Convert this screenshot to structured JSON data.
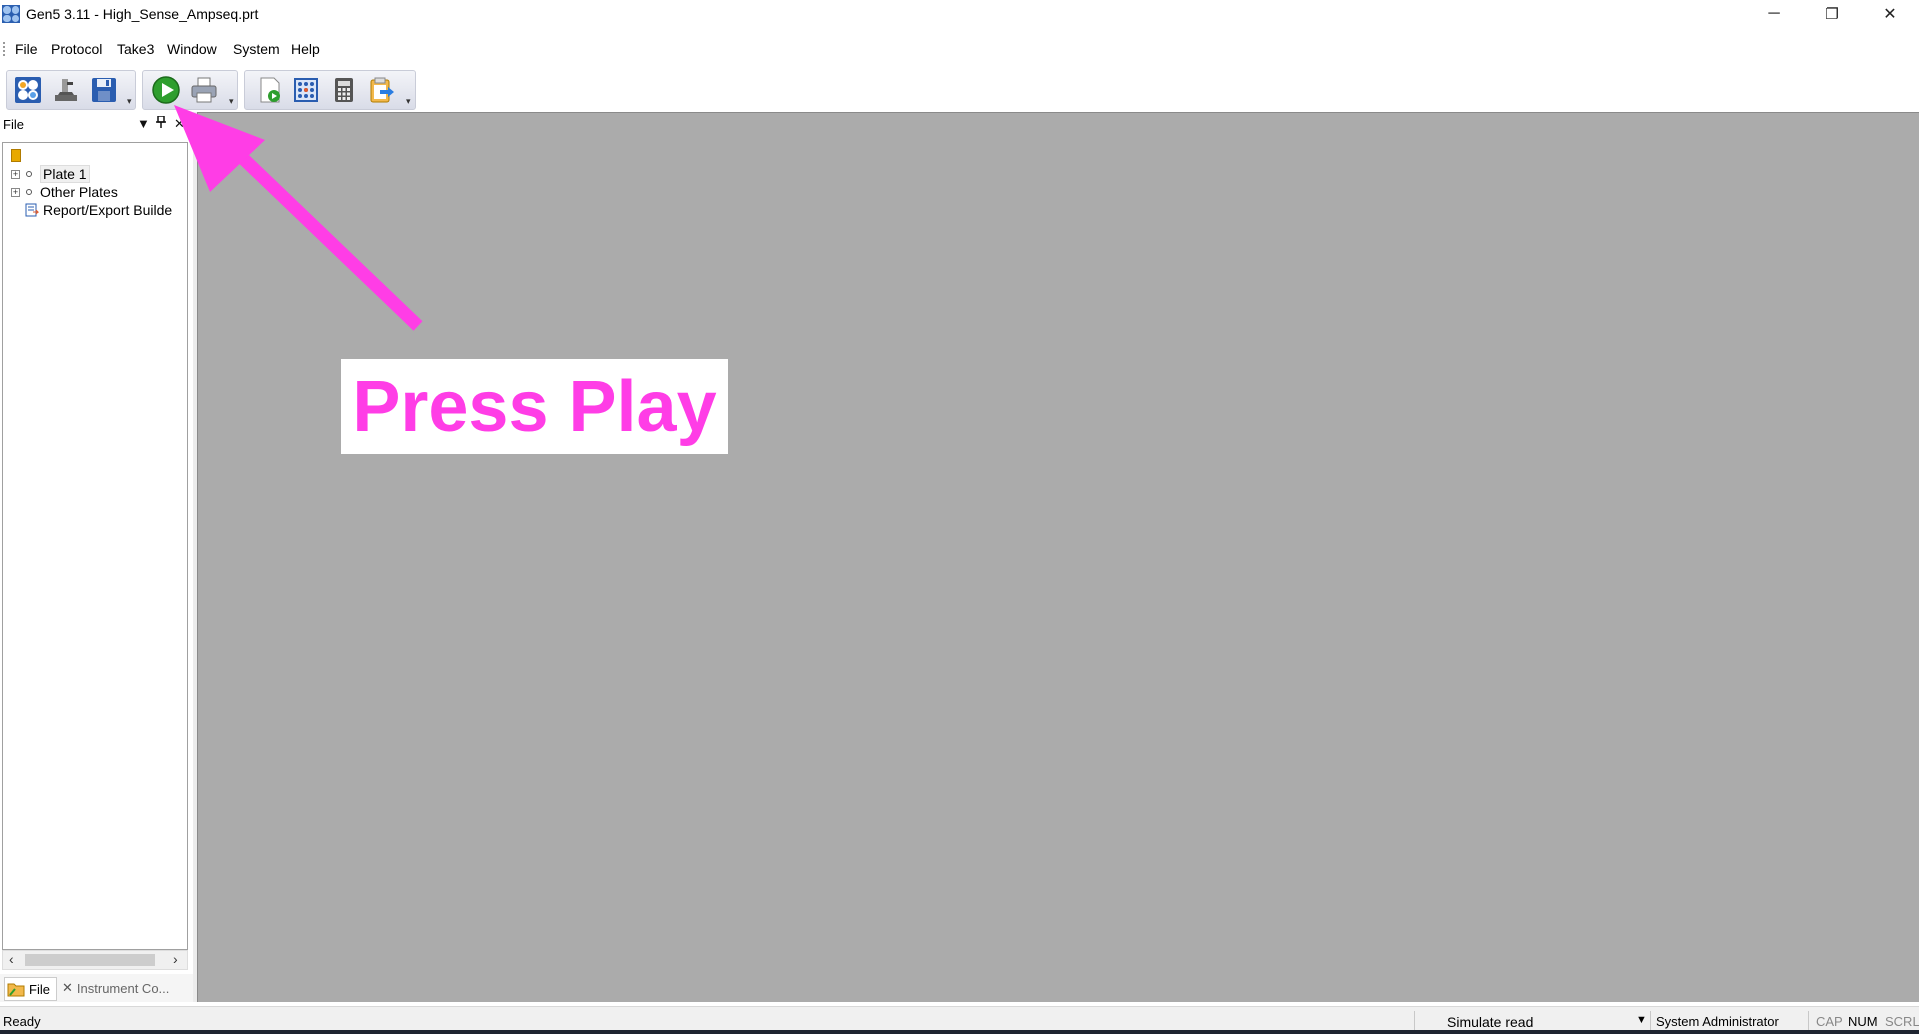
{
  "window": {
    "title": "Gen5 3.11 - High_Sense_Ampseq.prt",
    "controls": {
      "minimize": "─",
      "restore": "❐",
      "close": "✕"
    }
  },
  "menu": {
    "items": [
      {
        "label": "File"
      },
      {
        "label": "Protocol"
      },
      {
        "label": "Take3"
      },
      {
        "label": "Window"
      },
      {
        "label": "System"
      },
      {
        "label": "Help"
      }
    ]
  },
  "toolbar": {
    "buttons": [
      {
        "icon": "plate-layout-icon"
      },
      {
        "icon": "reader-control-icon"
      },
      {
        "icon": "save-icon"
      },
      {
        "icon": "play-read-icon"
      },
      {
        "icon": "print-icon"
      },
      {
        "icon": "new-experiment-icon"
      },
      {
        "icon": "plate-view-icon"
      },
      {
        "icon": "calculator-icon"
      },
      {
        "icon": "export-icon"
      }
    ]
  },
  "file_panel": {
    "title": "File",
    "tree": [
      {
        "label": "Plate 1",
        "expandable": true,
        "selected": true
      },
      {
        "label": "Other Plates",
        "expandable": true
      },
      {
        "label": "Report/Export Builde",
        "expandable": false
      }
    ],
    "tabs": [
      {
        "label": "File",
        "icon": "folder-icon"
      },
      {
        "label": "Instrument Co...",
        "icon": "tools-icon"
      }
    ]
  },
  "status": {
    "left": "Ready",
    "mode": "Simulate read",
    "user": "System Administrator",
    "indicators": [
      "CAP",
      "NUM",
      "SCRL"
    ]
  },
  "annotation": {
    "text": "Press Play",
    "color": "#ff3de6"
  }
}
